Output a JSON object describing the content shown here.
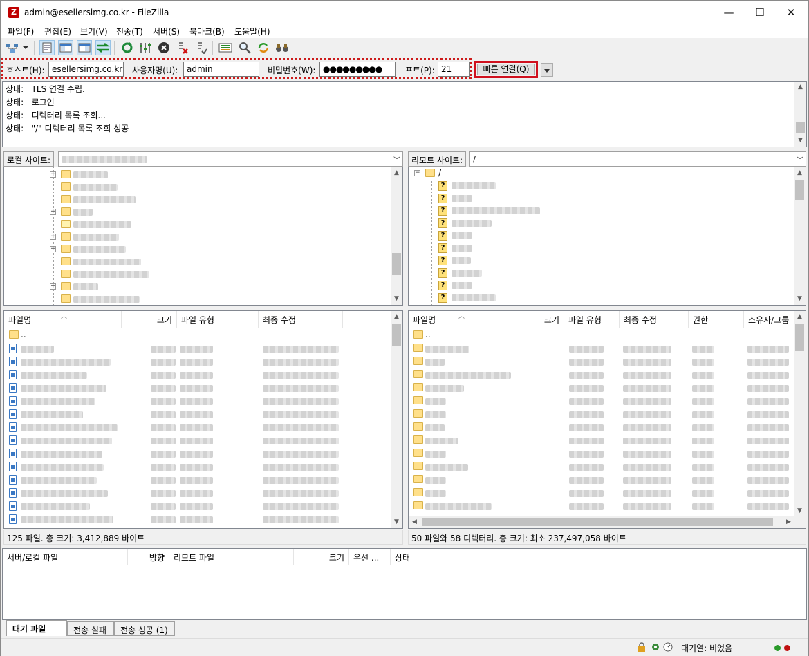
{
  "window": {
    "title": "admin@esellersimg.co.kr - FileZilla",
    "app_icon_letter": "Z",
    "minimize": "—",
    "maximize": "☐",
    "close": "✕"
  },
  "menu": [
    "파일(F)",
    "편집(E)",
    "보기(V)",
    "전송(T)",
    "서버(S)",
    "북마크(B)",
    "도움말(H)"
  ],
  "toolbar": {
    "icons": [
      "site-manager-icon",
      "dropdown-arrow-icon",
      "message-log-icon",
      "local-tree-icon",
      "remote-tree-icon",
      "transfer-queue-icon",
      "refresh-icon",
      "process-queue-icon",
      "cancel-icon",
      "disconnect-icon",
      "reconnect-icon",
      "directory-compare-icon",
      "filter-icon",
      "sync-browse-icon",
      "search-icon"
    ]
  },
  "quickconnect": {
    "host_label": "호스트(H):",
    "host_value": "esellersimg.co.kr",
    "user_label": "사용자명(U):",
    "user_value": "admin",
    "pass_label": "비밀번호(W):",
    "pass_value": "●●●●●●●●●",
    "port_label": "포트(P):",
    "port_value": "21",
    "connect_button": "빠른 연결(Q)",
    "highlight_color": "#cc1b1b"
  },
  "log": [
    {
      "prefix": "상태:",
      "text": "TLS 연결 수립."
    },
    {
      "prefix": "상태:",
      "text": "로그인"
    },
    {
      "prefix": "상태:",
      "text": "디렉터리 목록 조회..."
    },
    {
      "prefix": "상태:",
      "text": "\"/\" 디렉터리 목록 조회 성공"
    }
  ],
  "local": {
    "site_label": "로컬 사이트:",
    "columns": [
      "파일명",
      "크기",
      "파일 유형",
      "최종 수정"
    ],
    "parent": "..",
    "status": "125 파일. 총 크기: 3,412,889 바이트"
  },
  "remote": {
    "site_label": "리모트 사이트:",
    "path": "/",
    "root_node": "/",
    "columns": [
      "파일명",
      "크기",
      "파일 유형",
      "최종 수정",
      "권한",
      "소유자/그룹"
    ],
    "parent": "..",
    "status": "50 파일와 58 디렉터리. 총 크기: 최소 237,497,058 바이트"
  },
  "queue": {
    "columns": [
      "서버/로컬 파일",
      "방향",
      "리모트 파일",
      "크기",
      "우선 ...",
      "상태"
    ],
    "tabs": [
      "대기 파일",
      "전송 실패",
      "전송 성공 (1)"
    ],
    "active_tab": "대기 파일"
  },
  "statusbar": {
    "queue_text": "대기열: 비었음",
    "icons": [
      "lock-icon",
      "settings-gear-icon",
      "speed-limit-icon"
    ]
  },
  "colors": {
    "folder": "#ffe08a",
    "selected_tool": "#cce4f7",
    "led_green": "#2a9a2a",
    "led_red": "#c01010"
  }
}
